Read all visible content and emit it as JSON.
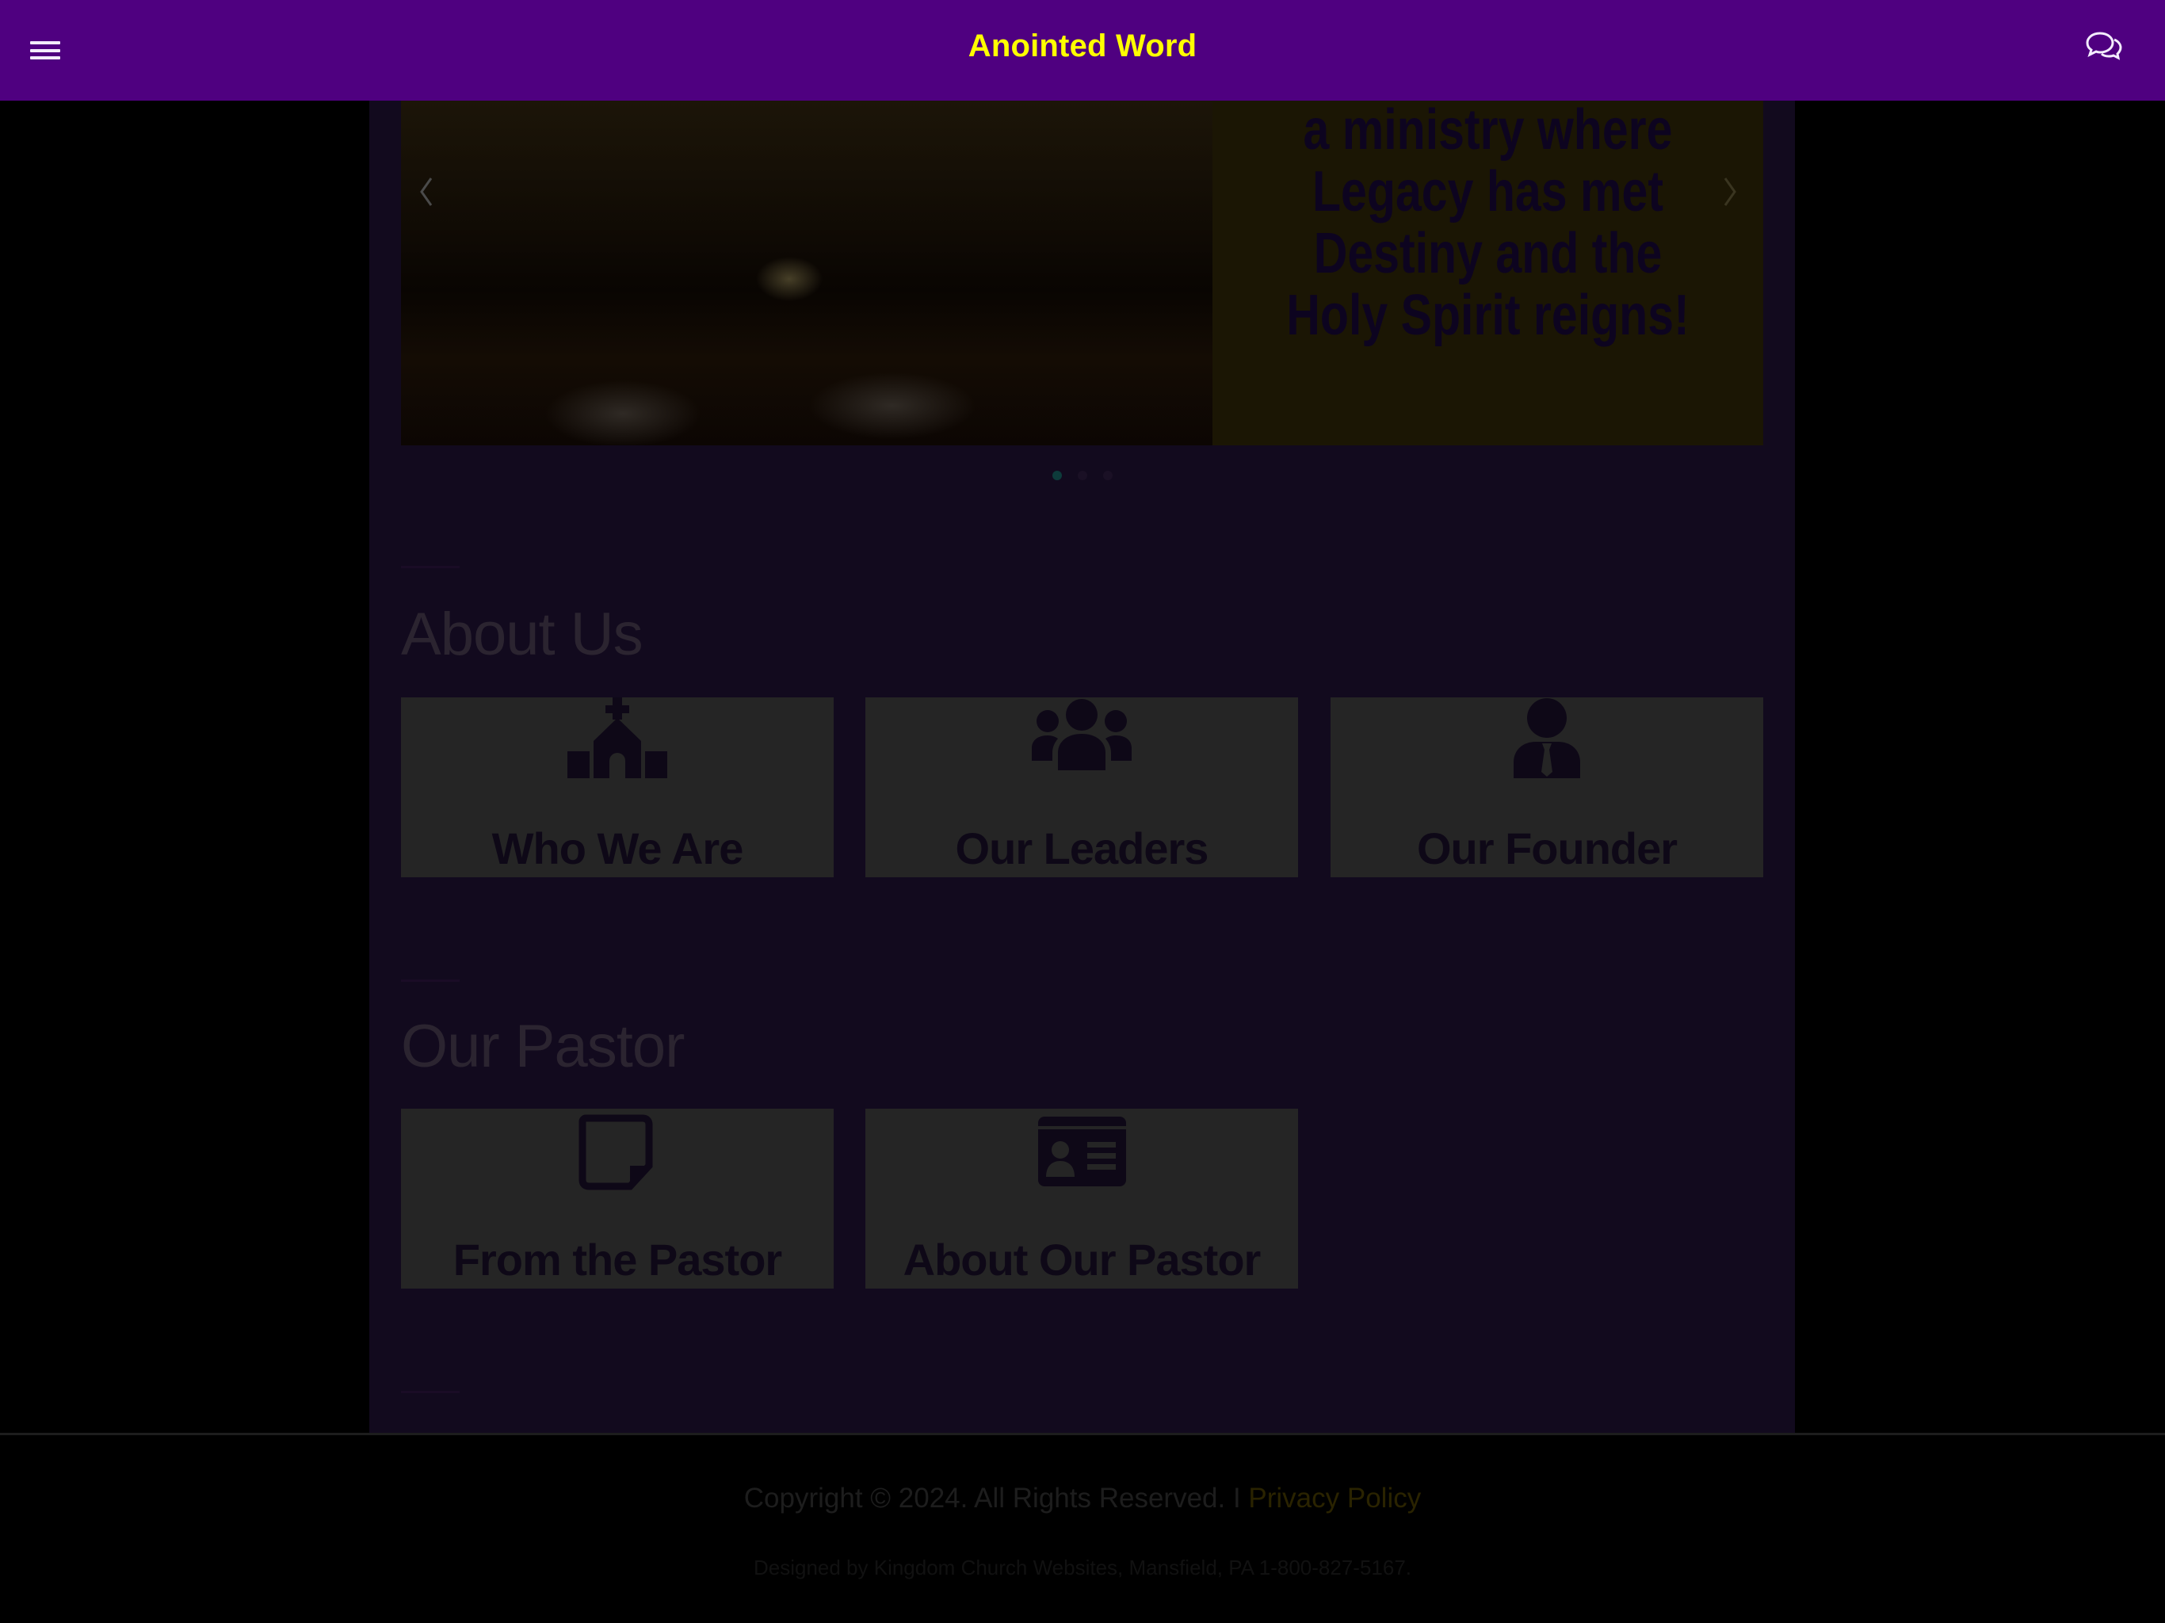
{
  "header": {
    "title": "Anointed Word",
    "menu_icon": "hamburger-menu-icon",
    "chat_icon": "chat-bubbles-icon",
    "background_color": "#4f0080",
    "title_color": "#ffff00"
  },
  "carousel": {
    "slide_text": "a ministry where Legacy has met Destiny and the Holy Spirit reigns!",
    "prev_icon": "chevron-left-icon",
    "next_icon": "chevron-right-icon",
    "dots": [
      {
        "active": true
      },
      {
        "active": false
      },
      {
        "active": false
      }
    ]
  },
  "sections": [
    {
      "title": "About Us",
      "cards": [
        {
          "label": "Who We Are",
          "icon": "church-icon"
        },
        {
          "label": "Our Leaders",
          "icon": "users-icon"
        },
        {
          "label": "Our Founder",
          "icon": "user-tie-icon"
        }
      ]
    },
    {
      "title": "Our Pastor",
      "cards": [
        {
          "label": "From the Pastor",
          "icon": "sticky-note-icon"
        },
        {
          "label": "About Our Pastor",
          "icon": "id-card-icon"
        }
      ]
    }
  ],
  "footer": {
    "copyright": "Copyright © 2024. All Rights Reserved. I ",
    "privacy_link": "Privacy Policy",
    "designed_by": "Designed by Kingdom Church Websites, Mansfield, PA 1-800-827-5167."
  }
}
